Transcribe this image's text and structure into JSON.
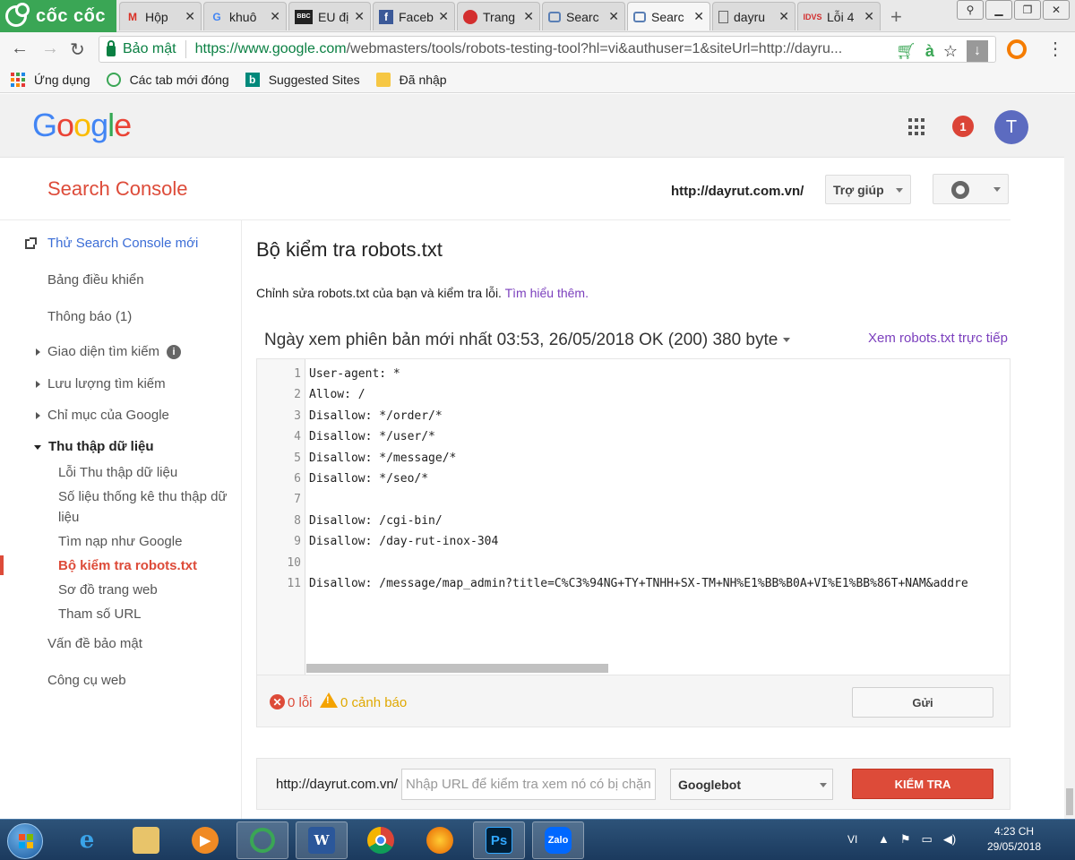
{
  "browser": {
    "brand": "cốc cốc",
    "tabs": [
      {
        "title": "Hộp",
        "icon": "gmail-icon"
      },
      {
        "title": "khuô",
        "icon": "google-icon"
      },
      {
        "title": "EU đị",
        "icon": "bbc-icon"
      },
      {
        "title": "Faceb",
        "icon": "facebook-icon"
      },
      {
        "title": "Trang",
        "icon": "site-icon"
      },
      {
        "title": "Searc",
        "icon": "search-console-icon"
      },
      {
        "title": "Searc",
        "icon": "search-console-icon"
      },
      {
        "title": "dayru",
        "icon": "page-icon"
      },
      {
        "title": "Lỗi 4",
        "icon": "idvs-icon"
      }
    ],
    "active_tab_index": 6,
    "secure_label": "Bảo mật",
    "url_host": "https://www.google.com",
    "url_rest": "/webmasters/tools/robots-testing-tool?hl=vi&authuser=1&siteUrl=http://dayru...",
    "bookmarks": [
      "Ứng dụng",
      "Các tab mới đóng",
      "Suggested Sites",
      "Đã nhập"
    ]
  },
  "google": {
    "logo": "Google",
    "notification_count": "1",
    "avatar_letter": "T"
  },
  "console": {
    "title": "Search Console",
    "site": "http://dayrut.com.vn/",
    "help_label": "Trợ giúp"
  },
  "sidebar": {
    "new_console": "Thử Search Console mới",
    "items": [
      "Bảng điều khiển",
      "Thông báo (1)",
      "Giao diện tìm kiếm",
      "Lưu lượng tìm kiếm",
      "Chỉ mục của Google",
      "Thu thập dữ liệu"
    ],
    "crawl_sub": [
      "Lỗi Thu thập dữ liệu",
      "Số liệu thống kê thu thập dữ",
      "liệu",
      "Tìm nạp như Google",
      "Bộ kiểm tra robots.txt",
      "Sơ đồ trang web",
      "Tham số URL"
    ],
    "after": [
      "Vấn đề bảo mật",
      "Công cụ web"
    ]
  },
  "main": {
    "title": "Bộ kiểm tra robots.txt",
    "description": "Chỉnh sửa robots.txt của bạn và kiểm tra lỗi.",
    "learn_more": "Tìm hiểu thêm.",
    "version": "Ngày xem phiên bản mới nhất 03:53, 26/05/2018 OK (200) 380 byte",
    "live_link": "Xem robots.txt trực tiếp",
    "lines": [
      {
        "n": "1",
        "text": "User-agent: *"
      },
      {
        "n": "2",
        "text": "Allow: /"
      },
      {
        "n": "3",
        "text": "Disallow: */order/*"
      },
      {
        "n": "4",
        "text": "Disallow: */user/*"
      },
      {
        "n": "5",
        "text": "Disallow: */message/*"
      },
      {
        "n": "6",
        "text": "Disallow: */seo/*"
      },
      {
        "n": "7",
        "text": ""
      },
      {
        "n": "8",
        "text": "Disallow: /cgi-bin/"
      },
      {
        "n": "9",
        "text": "Disallow: /day-rut-inox-304"
      },
      {
        "n": "10",
        "text": ""
      },
      {
        "n": "11",
        "text": "Disallow: /message/map_admin?title=C%C3%94NG+TY+TNHH+SX-TM+NH%E1%BB%B0A+VI%E1%BB%86T+NAM&addre"
      }
    ],
    "errors": "0 lỗi",
    "warnings": "0 cảnh báo",
    "submit_label": "Gửi",
    "test_site": "http://dayrut.com.vn/",
    "test_placeholder": "Nhập URL để kiểm tra xem nó có bị chặn",
    "bot": "Googlebot",
    "test_label": "KIỂM TRA"
  },
  "taskbar": {
    "lang": "VI",
    "time": "4:23 CH",
    "date": "29/05/2018"
  }
}
